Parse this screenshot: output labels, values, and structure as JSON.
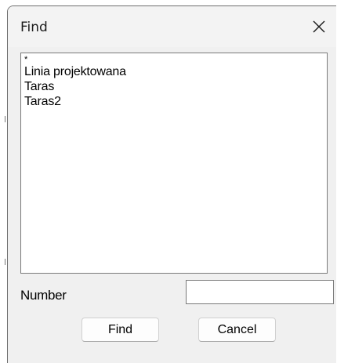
{
  "dialog": {
    "title": "Find",
    "close_icon": "close-icon"
  },
  "list": {
    "items": [
      "*",
      "Linia projektowana",
      "Taras",
      "Taras2"
    ]
  },
  "number": {
    "label": "Number",
    "value": ""
  },
  "buttons": {
    "find_label": "Find",
    "cancel_label": "Cancel"
  },
  "colors": {
    "dialog_background": "#f0f0f0",
    "titlebar_background": "#f3f3f3",
    "field_border": "#7a7a7a"
  }
}
